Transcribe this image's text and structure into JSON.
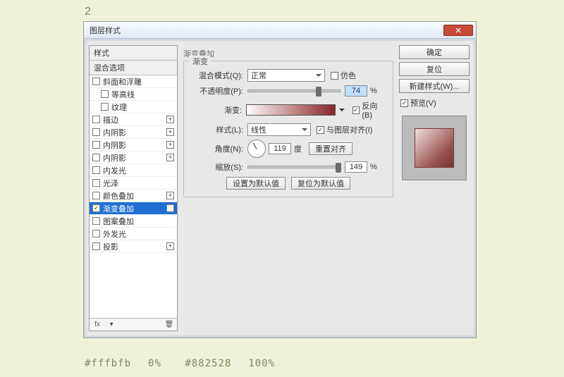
{
  "page": {
    "step_label": "2",
    "footnote_color1": "#fffbfb",
    "footnote_pct1": "0%",
    "footnote_color2": "#882528",
    "footnote_pct2": "100%"
  },
  "dialog": {
    "title": "图层样式"
  },
  "styles": {
    "header": "样式",
    "blend_header": "混合选项",
    "items": [
      {
        "label": "斜面和浮雕",
        "checked": false,
        "expand": false
      },
      {
        "label": "等高线",
        "checked": false,
        "indent": true
      },
      {
        "label": "纹理",
        "checked": false,
        "indent": true
      },
      {
        "label": "描边",
        "checked": false,
        "expand": true
      },
      {
        "label": "内阴影",
        "checked": false,
        "expand": true
      },
      {
        "label": "内阴影",
        "checked": false,
        "expand": true
      },
      {
        "label": "内阴影",
        "checked": false,
        "expand": true
      },
      {
        "label": "内发光",
        "checked": false
      },
      {
        "label": "光泽",
        "checked": false
      },
      {
        "label": "颜色叠加",
        "checked": false,
        "expand": true
      },
      {
        "label": "渐变叠加",
        "checked": true,
        "expand": true,
        "selected": true
      },
      {
        "label": "图案叠加",
        "checked": false
      },
      {
        "label": "外发光",
        "checked": false
      },
      {
        "label": "投影",
        "checked": false,
        "expand": true
      }
    ]
  },
  "settings": {
    "section_title": "渐变叠加",
    "group_legend": "渐变",
    "blend_mode_label": "混合模式(Q):",
    "blend_mode_value": "正常",
    "dither_label": "仿色",
    "opacity_label": "不透明度(P):",
    "opacity_value": "74",
    "pct": "%",
    "gradient_label": "渐变:",
    "reverse_label": "反向(B)",
    "reverse_checked": true,
    "style_label": "样式(L):",
    "style_value": "线性",
    "align_label": "与图层对齐(I)",
    "align_checked": true,
    "angle_label": "角度(N):",
    "angle_value": "119",
    "degree": "度",
    "reset_align": "重置对齐",
    "scale_label": "缩放(S):",
    "scale_value": "149",
    "set_default": "设置为默认值",
    "reset_default": "复位为默认值"
  },
  "right": {
    "ok": "确定",
    "cancel": "复位",
    "new_style": "新建样式(W)...",
    "preview_label": "预览(V)",
    "preview_checked": true
  }
}
